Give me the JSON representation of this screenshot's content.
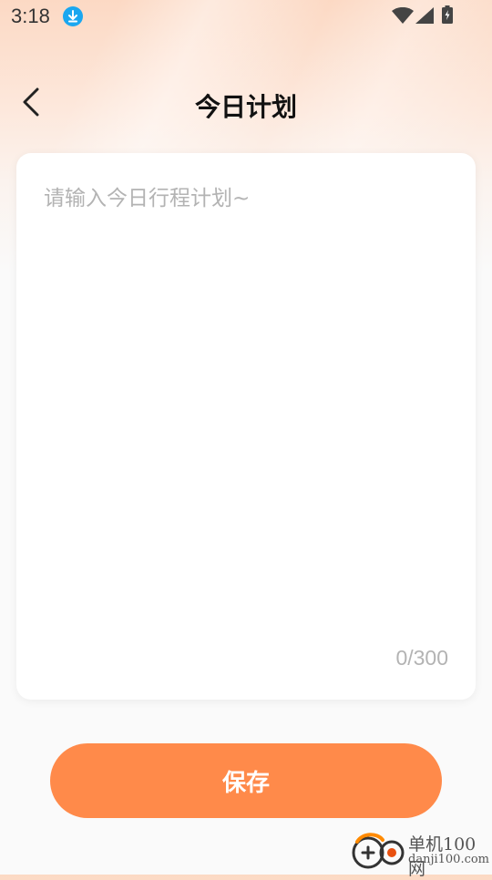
{
  "status_bar": {
    "time": "3:18",
    "icons": [
      "download-icon",
      "wifi-icon",
      "signal-icon",
      "battery-icon"
    ]
  },
  "header": {
    "title": "今日计划",
    "back_icon": "chevron-left-icon"
  },
  "editor": {
    "placeholder": "请输入今日行程计划~",
    "value": "",
    "counter": "0/300"
  },
  "actions": {
    "save_label": "保存"
  },
  "watermark": {
    "text_cn": "单机100网",
    "text_en": "danji100.com"
  },
  "colors": {
    "accent": "#ff8a4a",
    "header_gradient_top": "#fcd9c4",
    "background": "#fafafa",
    "download_badge": "#1aa7f0",
    "placeholder": "#b3b3b3"
  }
}
